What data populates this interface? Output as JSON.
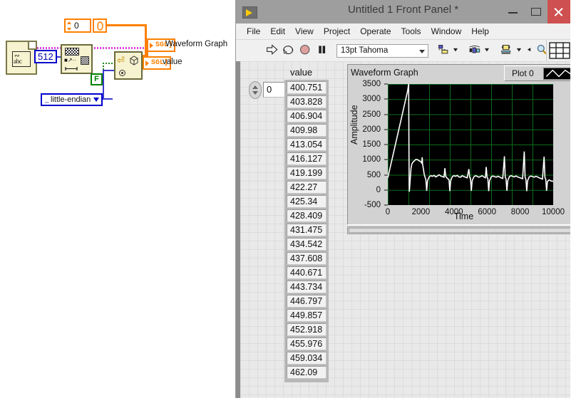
{
  "block_diagram": {
    "string_constant": {
      "icon": "string-abc-icon",
      "label": "abc"
    },
    "numeric_constant_512": "512",
    "ramp_node": {
      "icon": "pattern-generator-icon"
    },
    "numeric_control": {
      "value": "0",
      "coercion_value": "0"
    },
    "boolean_constant": "F",
    "enum_control": {
      "value": "little-endian"
    },
    "typecast_node": {
      "icon": "unflatten-from-string-icon"
    },
    "indicators": [
      {
        "type": "SGL",
        "label": "Waveform Graph"
      },
      {
        "type": "SGL",
        "label": "value"
      }
    ]
  },
  "window": {
    "title": "Untitled 1 Front Panel *",
    "app_icon": "labview-run-icon",
    "buttons": {
      "minimize": "minimize-icon",
      "maximize": "maximize-icon",
      "close": "close-icon"
    }
  },
  "menu": {
    "items": [
      "File",
      "Edit",
      "View",
      "Project",
      "Operate",
      "Tools",
      "Window",
      "Help"
    ]
  },
  "toolbar": {
    "run_label": "run-arrow-icon",
    "run_continuous_label": "run-continuously-icon",
    "abort_label": "abort-execution-icon",
    "pause_label": "pause-icon",
    "font_selector": {
      "value": "13pt Tahoma",
      "placeholder": "13pt Tahoma"
    },
    "align_label": "align-objects-icon",
    "distribute_label": "distribute-objects-icon",
    "resize_label": "resize-objects-icon",
    "reorder_label": "reorder-icon",
    "search_label": "search-icon",
    "help_label": "context-help-icon",
    "grid_label": "grid-icon"
  },
  "panel": {
    "index_control": {
      "value": "0",
      "icon": "index-spinner-icon"
    },
    "array": {
      "label": "value",
      "values": [
        "400.751",
        "403.828",
        "406.904",
        "409.98",
        "413.054",
        "416.127",
        "419.199",
        "422.27",
        "425.34",
        "428.409",
        "431.475",
        "434.542",
        "437.608",
        "440.671",
        "443.734",
        "446.797",
        "449.857",
        "452.918",
        "455.976",
        "459.034",
        "462.09"
      ]
    },
    "graph": {
      "title": "Waveform Graph",
      "legend": {
        "plot_name": "Plot 0",
        "swatch": "plot-line-icon"
      },
      "scrollbar": "horizontal-scrollbar"
    }
  },
  "chart_data": {
    "type": "line",
    "title": "Waveform Graph",
    "xlabel": "Time",
    "ylabel": "Amplitude",
    "xlim": [
      0,
      10000
    ],
    "ylim": [
      -500,
      3500
    ],
    "xticks": [
      0,
      2000,
      4000,
      6000,
      8000,
      10000
    ],
    "yticks": [
      -500,
      0,
      500,
      1000,
      1500,
      2000,
      2500,
      3000,
      3500
    ],
    "grid": true,
    "legend_position": "top-right",
    "series": [
      {
        "name": "Plot 0",
        "color": "#ffffff",
        "points": [
          [
            0,
            400
          ],
          [
            100,
            640
          ],
          [
            200,
            880
          ],
          [
            300,
            1120
          ],
          [
            400,
            1360
          ],
          [
            500,
            1600
          ],
          [
            600,
            1840
          ],
          [
            700,
            2080
          ],
          [
            800,
            2320
          ],
          [
            900,
            2560
          ],
          [
            1000,
            2800
          ],
          [
            1100,
            3040
          ],
          [
            1200,
            3280
          ],
          [
            1260,
            3500
          ],
          [
            1270,
            2400
          ],
          [
            1280,
            1200
          ],
          [
            1290,
            200
          ],
          [
            1300,
            -60
          ],
          [
            1350,
            300
          ],
          [
            1400,
            700
          ],
          [
            1450,
            850
          ],
          [
            1500,
            900
          ],
          [
            1600,
            960
          ],
          [
            1700,
            1010
          ],
          [
            1800,
            1000
          ],
          [
            1900,
            960
          ],
          [
            2000,
            930
          ],
          [
            2050,
            890
          ],
          [
            2080,
            1080
          ],
          [
            2100,
            860
          ],
          [
            2150,
            700
          ],
          [
            2200,
            520
          ],
          [
            2250,
            420
          ],
          [
            2300,
            350
          ],
          [
            2350,
            -30
          ],
          [
            2400,
            300
          ],
          [
            2500,
            430
          ],
          [
            2600,
            470
          ],
          [
            2700,
            450
          ],
          [
            2800,
            480
          ],
          [
            2900,
            430
          ],
          [
            3000,
            460
          ],
          [
            3100,
            500
          ],
          [
            3200,
            460
          ],
          [
            3300,
            440
          ],
          [
            3400,
            420
          ],
          [
            3450,
            720
          ],
          [
            3500,
            450
          ],
          [
            3600,
            380
          ],
          [
            3700,
            340
          ],
          [
            3750,
            -40
          ],
          [
            3800,
            300
          ],
          [
            3900,
            440
          ],
          [
            4000,
            470
          ],
          [
            4100,
            450
          ],
          [
            4200,
            480
          ],
          [
            4300,
            430
          ],
          [
            4400,
            420
          ],
          [
            4500,
            470
          ],
          [
            4600,
            440
          ],
          [
            4700,
            420
          ],
          [
            4800,
            400
          ],
          [
            4900,
            690
          ],
          [
            4950,
            420
          ],
          [
            5000,
            370
          ],
          [
            5050,
            -30
          ],
          [
            5100,
            300
          ],
          [
            5200,
            430
          ],
          [
            5300,
            470
          ],
          [
            5400,
            450
          ],
          [
            5500,
            420
          ],
          [
            5600,
            440
          ],
          [
            5700,
            470
          ],
          [
            5800,
            430
          ],
          [
            5900,
            400
          ],
          [
            5950,
            760
          ],
          [
            6000,
            420
          ],
          [
            6050,
            370
          ],
          [
            6100,
            -40
          ],
          [
            6150,
            300
          ],
          [
            6250,
            430
          ],
          [
            6350,
            460
          ],
          [
            6450,
            440
          ],
          [
            6550,
            420
          ],
          [
            6650,
            450
          ],
          [
            6750,
            430
          ],
          [
            6850,
            400
          ],
          [
            6950,
            380
          ],
          [
            7050,
            1110
          ],
          [
            7100,
            420
          ],
          [
            7150,
            360
          ],
          [
            7200,
            -30
          ],
          [
            7250,
            300
          ],
          [
            7350,
            440
          ],
          [
            7450,
            470
          ],
          [
            7550,
            450
          ],
          [
            7650,
            430
          ],
          [
            7750,
            460
          ],
          [
            7850,
            430
          ],
          [
            7950,
            410
          ],
          [
            8050,
            390
          ],
          [
            8150,
            370
          ],
          [
            8250,
            1270
          ],
          [
            8300,
            420
          ],
          [
            8350,
            350
          ],
          [
            8400,
            -40
          ],
          [
            8450,
            300
          ],
          [
            8550,
            430
          ],
          [
            8650,
            460
          ],
          [
            8750,
            440
          ],
          [
            8850,
            420
          ],
          [
            8950,
            450
          ],
          [
            9050,
            430
          ],
          [
            9150,
            400
          ],
          [
            9250,
            380
          ],
          [
            9350,
            360
          ],
          [
            9450,
            1100
          ],
          [
            9500,
            420
          ],
          [
            9550,
            350
          ],
          [
            9600,
            -30
          ],
          [
            9650,
            280
          ],
          [
            9750,
            330
          ],
          [
            9850,
            300
          ],
          [
            9950,
            290
          ],
          [
            10000,
            280
          ]
        ]
      }
    ]
  }
}
